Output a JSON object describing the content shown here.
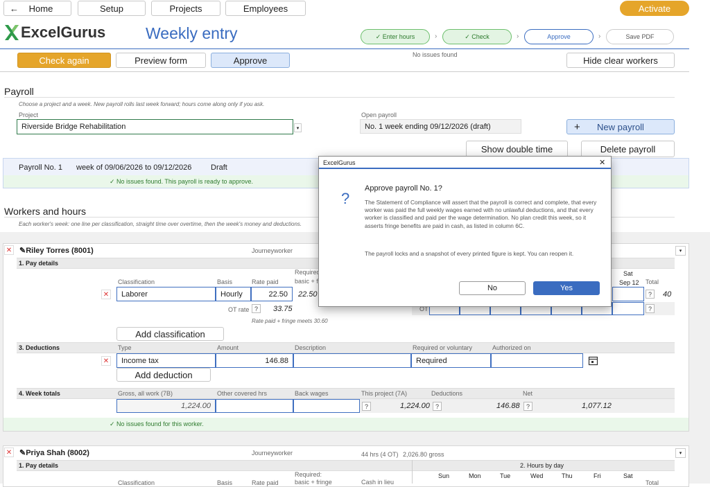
{
  "topbar": {
    "home": "Home",
    "setup": "Setup",
    "projects": "Projects",
    "employees": "Employees",
    "activate": "Activate"
  },
  "brand": {
    "name": "ExcelGurus",
    "page_title": "Weekly entry"
  },
  "steps": {
    "s1": "✓ Enter hours",
    "s2": "✓ Check",
    "s3": "Approve",
    "s4": "Save PDF"
  },
  "toolbar": {
    "check_again": "Check again",
    "preview": "Preview form",
    "approve": "Approve",
    "status": "No issues found",
    "hide_clear": "Hide clear workers"
  },
  "payroll": {
    "heading": "Payroll",
    "help": "Choose a project and a week. New payroll rolls last week forward; hours come along only if you ask.",
    "project_label": "Project",
    "project_value": "Riverside Bridge Rehabilitation",
    "open_label": "Open payroll",
    "open_value": "No. 1   week ending 09/12/2026  (draft)",
    "new_payroll": "New payroll",
    "show_double": "Show double time",
    "delete": "Delete payroll"
  },
  "summary": {
    "no": "Payroll No. 1",
    "week": "week of 09/06/2026 to 09/12/2026",
    "state": "Draft",
    "ok": "✓  No issues found. This payroll is ready to approve."
  },
  "workers": {
    "heading": "Workers and hours",
    "help": "Each worker's week: one line per classification, straight time over overtime, then the week's money and deductions."
  },
  "w1": {
    "name": "Riley Torres (8001)",
    "title": "Journeyworker",
    "sec1": "1. Pay details",
    "col_class": "Classification",
    "col_basis": "Basis",
    "col_rate": "Rate paid",
    "col_req": "Required:",
    "col_req2": "basic + f",
    "class": "Laborer",
    "basis": "Hourly",
    "rate": "22.50",
    "req": "22.50",
    "ot_rate_lbl": "OT rate",
    "ot_rate": "33.75",
    "fringe_note": "Rate paid + fringe meets 30.60",
    "sat": "Sat",
    "sat_date": "Sep 12",
    "total": "Total",
    "total_val": "40",
    "ot": "OT",
    "add_class": "Add classification",
    "sec3": "3. Deductions",
    "d_type": "Type",
    "d_amount": "Amount",
    "d_desc": "Description",
    "d_req": "Required or voluntary",
    "d_auth": "Authorized on",
    "ded_type": "Income tax",
    "ded_amount": "146.88",
    "ded_req": "Required",
    "add_ded": "Add deduction",
    "sec4": "4. Week totals",
    "t_gross": "Gross, all work (7B)",
    "t_other": "Other covered hrs",
    "t_back": "Back wages",
    "t_proj": "This project (7A)",
    "t_ded": "Deductions",
    "t_net": "Net",
    "gross": "1,224.00",
    "proj": "1,224.00",
    "ded": "146.88",
    "net": "1,077.12",
    "ok": "✓  No issues found for this worker."
  },
  "w2": {
    "name": "Priya Shah (8002)",
    "title": "Journeyworker",
    "hours": "44 hrs (4 OT)",
    "gross": "2,026.80 gross",
    "sec1": "1. Pay details",
    "hours_by_day": "2. Hours by day",
    "days": [
      "Sun",
      "Mon",
      "Tue",
      "Wed",
      "Thu",
      "Fri",
      "Sat"
    ],
    "req": "Required:",
    "req2": "basic + fringe",
    "cash": "Cash in lieu",
    "col_class": "Classification",
    "col_basis": "Basis",
    "col_rate": "Rate paid",
    "total": "Total"
  },
  "dialog": {
    "title": "ExcelGurus",
    "close": "✕",
    "icon": "?",
    "heading": "Approve payroll No. 1?",
    "body1": "The Statement of Compliance will assert that the payroll is correct and complete, that every worker was paid the full weekly wages earned with no unlawful deductions, and that every worker is classified and paid per the wage determination. No plan credit this week, so it asserts fringe benefits are paid in cash, as listed in column 6C.",
    "body2": "The payroll locks and a snapshot of every printed figure is kept. You can reopen it.",
    "no": "No",
    "yes": "Yes"
  }
}
